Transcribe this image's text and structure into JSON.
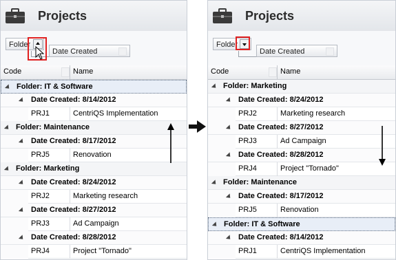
{
  "header": {
    "title": "Projects",
    "icon": "briefcase-icon"
  },
  "groupbar": {
    "folder_chip": "Folder",
    "date_chip": "Date Created"
  },
  "columns": {
    "code": "Code",
    "name": "Name"
  },
  "left_rows": [
    {
      "type": "folder",
      "text": "Folder: IT & Software",
      "selected": true
    },
    {
      "type": "date",
      "text": "Date Created: 8/14/2012"
    },
    {
      "type": "item",
      "code": "PRJ1",
      "name": "CentriQS Implementation"
    },
    {
      "type": "folder",
      "text": "Folder: Maintenance"
    },
    {
      "type": "date",
      "text": "Date Created: 8/17/2012"
    },
    {
      "type": "item",
      "code": "PRJ5",
      "name": "Renovation"
    },
    {
      "type": "folder",
      "text": "Folder: Marketing"
    },
    {
      "type": "date",
      "text": "Date Created: 8/24/2012"
    },
    {
      "type": "item",
      "code": "PRJ2",
      "name": "Marketing research"
    },
    {
      "type": "date",
      "text": "Date Created: 8/27/2012"
    },
    {
      "type": "item",
      "code": "PRJ3",
      "name": "Ad Campaign"
    },
    {
      "type": "date",
      "text": "Date Created: 8/28/2012"
    },
    {
      "type": "item",
      "code": "PRJ4",
      "name": "Project \"Tornado\""
    }
  ],
  "right_rows": [
    {
      "type": "folder",
      "text": "Folder: Marketing"
    },
    {
      "type": "date",
      "text": "Date Created: 8/24/2012"
    },
    {
      "type": "item",
      "code": "PRJ2",
      "name": "Marketing research"
    },
    {
      "type": "date",
      "text": "Date Created: 8/27/2012"
    },
    {
      "type": "item",
      "code": "PRJ3",
      "name": "Ad Campaign"
    },
    {
      "type": "date",
      "text": "Date Created: 8/28/2012"
    },
    {
      "type": "item",
      "code": "PRJ4",
      "name": "Project \"Tornado\""
    },
    {
      "type": "folder",
      "text": "Folder: Maintenance"
    },
    {
      "type": "date",
      "text": "Date Created: 8/17/2012"
    },
    {
      "type": "item",
      "code": "PRJ5",
      "name": "Renovation"
    },
    {
      "type": "folder",
      "text": "Folder: IT & Software",
      "selected": true
    },
    {
      "type": "date",
      "text": "Date Created: 8/14/2012"
    },
    {
      "type": "item",
      "code": "PRJ1",
      "name": "CentriQS Implementation"
    }
  ],
  "colors": {
    "highlight": "#e02020",
    "selected_row": "#e8eef7"
  }
}
